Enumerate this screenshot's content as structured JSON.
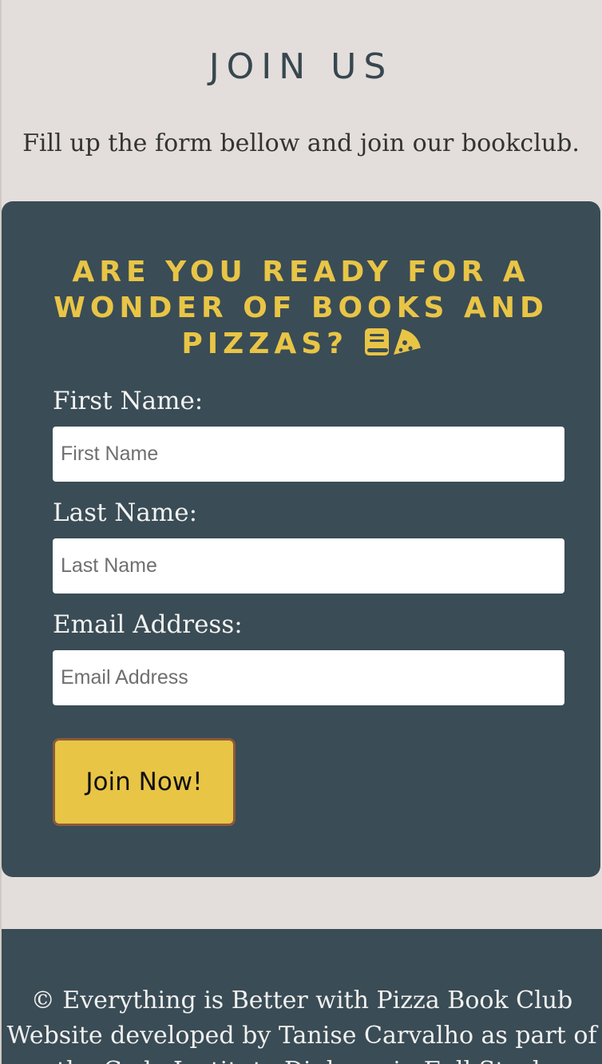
{
  "header": {
    "title": "JOIN US",
    "intro": "Fill up the form bellow and join our bookclub."
  },
  "form": {
    "heading": "ARE YOU READY FOR A WONDER OF BOOKS AND PIZZAS?",
    "heading_icons": [
      "book-icon",
      "pizza-slice-icon"
    ],
    "fields": [
      {
        "label": "First Name:",
        "placeholder": "First Name",
        "value": ""
      },
      {
        "label": "Last Name:",
        "placeholder": "Last Name",
        "value": ""
      },
      {
        "label": "Email Address:",
        "placeholder": "Email Address",
        "value": ""
      }
    ],
    "submit_label": "Join Now!"
  },
  "footer": {
    "copyright": "© Everything is Better with Pizza Book Club",
    "credit": "Website developed by Tanise Carvalho as part of the Code Institute Diploma in Full Stack"
  },
  "colors": {
    "background": "#e3dedb",
    "panel": "#3a4c55",
    "accent_yellow": "#e9c546",
    "title_dark": "#37474f",
    "button_border": "#8a5a3c"
  }
}
